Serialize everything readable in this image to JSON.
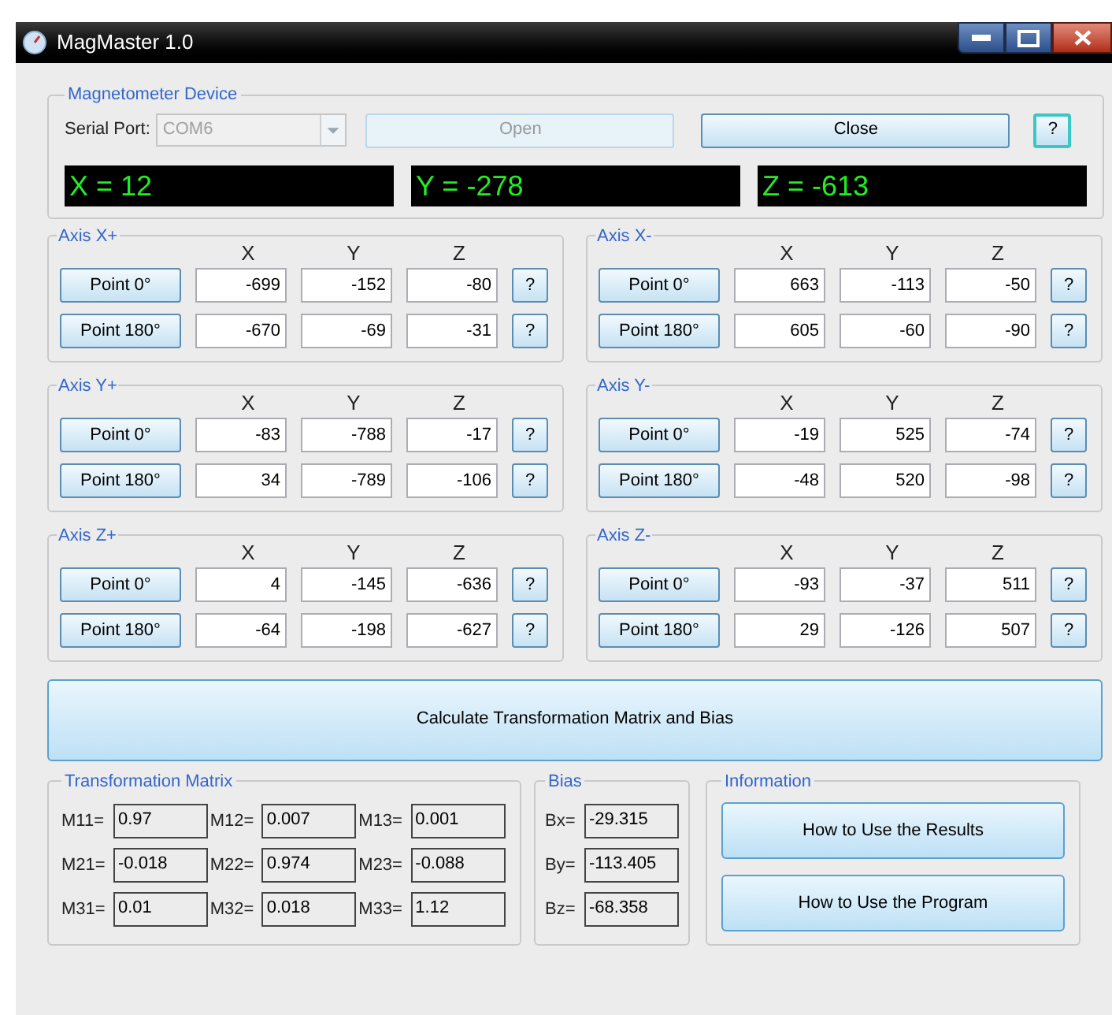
{
  "window": {
    "title": "MagMaster 1.0"
  },
  "device": {
    "title": "Magnetometer Device",
    "port_label": "Serial Port:",
    "port_value": "COM6",
    "port_disabled": true,
    "open": {
      "label": "Open",
      "disabled": true
    },
    "close": {
      "label": "Close",
      "disabled": false
    },
    "help": "?",
    "readouts": [
      "X = 12",
      "Y = -278",
      "Z = -613"
    ]
  },
  "axes": [
    {
      "title": "Axis X+",
      "columns": [
        "X",
        "Y",
        "Z"
      ],
      "rows": [
        {
          "button": "Point 0°",
          "values": [
            "-699",
            "-152",
            "-80"
          ],
          "help": "?"
        },
        {
          "button": "Point 180°",
          "values": [
            "-670",
            "-69",
            "-31"
          ],
          "help": "?"
        }
      ]
    },
    {
      "title": "Axis X-",
      "columns": [
        "X",
        "Y",
        "Z"
      ],
      "rows": [
        {
          "button": "Point 0°",
          "values": [
            "663",
            "-113",
            "-50"
          ],
          "help": "?"
        },
        {
          "button": "Point 180°",
          "values": [
            "605",
            "-60",
            "-90"
          ],
          "help": "?"
        }
      ]
    },
    {
      "title": "Axis Y+",
      "columns": [
        "X",
        "Y",
        "Z"
      ],
      "rows": [
        {
          "button": "Point 0°",
          "values": [
            "-83",
            "-788",
            "-17"
          ],
          "help": "?"
        },
        {
          "button": "Point 180°",
          "values": [
            "34",
            "-789",
            "-106"
          ],
          "help": "?"
        }
      ]
    },
    {
      "title": "Axis Y-",
      "columns": [
        "X",
        "Y",
        "Z"
      ],
      "rows": [
        {
          "button": "Point 0°",
          "values": [
            "-19",
            "525",
            "-74"
          ],
          "help": "?"
        },
        {
          "button": "Point 180°",
          "values": [
            "-48",
            "520",
            "-98"
          ],
          "help": "?"
        }
      ]
    },
    {
      "title": "Axis Z+",
      "columns": [
        "X",
        "Y",
        "Z"
      ],
      "rows": [
        {
          "button": "Point 0°",
          "values": [
            "4",
            "-145",
            "-636"
          ],
          "help": "?"
        },
        {
          "button": "Point 180°",
          "values": [
            "-64",
            "-198",
            "-627"
          ],
          "help": "?"
        }
      ]
    },
    {
      "title": "Axis Z-",
      "columns": [
        "X",
        "Y",
        "Z"
      ],
      "rows": [
        {
          "button": "Point 0°",
          "values": [
            "-93",
            "-37",
            "511"
          ],
          "help": "?"
        },
        {
          "button": "Point 180°",
          "values": [
            "29",
            "-126",
            "507"
          ],
          "help": "?"
        }
      ]
    }
  ],
  "calculate_button": "Calculate Transformation Matrix and Bias",
  "matrix": {
    "title": "Transformation Matrix",
    "cells": [
      {
        "label": "M11=",
        "value": "0.97"
      },
      {
        "label": "M12=",
        "value": "0.007"
      },
      {
        "label": "M13=",
        "value": "0.001"
      },
      {
        "label": "M21=",
        "value": "-0.018"
      },
      {
        "label": "M22=",
        "value": "0.974"
      },
      {
        "label": "M23=",
        "value": "-0.088"
      },
      {
        "label": "M31=",
        "value": "0.01"
      },
      {
        "label": "M32=",
        "value": "0.018"
      },
      {
        "label": "M33=",
        "value": "1.12"
      }
    ]
  },
  "bias": {
    "title": "Bias",
    "cells": [
      {
        "label": "Bx=",
        "value": "-29.315"
      },
      {
        "label": "By=",
        "value": "-113.405"
      },
      {
        "label": "Bz=",
        "value": "-68.358"
      }
    ]
  },
  "information": {
    "title": "Information",
    "buttons": [
      "How to Use the Results",
      "How to Use the Program"
    ]
  }
}
